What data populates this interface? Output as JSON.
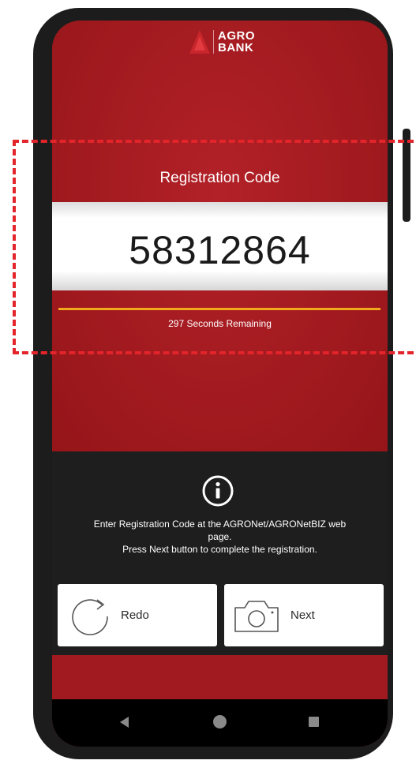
{
  "app": {
    "brand": "AGRO BANK",
    "brand_line1": "AGRO",
    "brand_line2": "BANK"
  },
  "registration": {
    "title": "Registration Code",
    "code": "58312864",
    "remaining_text": "297 Seconds Remaining",
    "progress_fraction": 1.0
  },
  "info": {
    "icon": "info-circle-icon",
    "line1": "Enter Registration Code at the AGRONet/AGRONetBIZ web",
    "line2": "page.",
    "line3": "Press Next button to complete the registration."
  },
  "actions": {
    "redo_label": "Redo",
    "redo_icon": "redo-arrow-icon",
    "next_label": "Next",
    "next_icon": "camera-icon"
  },
  "nav": {
    "back_icon": "back-triangle-icon",
    "home_icon": "home-circle-icon",
    "recent_icon": "recent-square-icon"
  },
  "colors": {
    "brand_red": "#a11a1f",
    "panel_dark": "#1e1e1e",
    "progress_accent": "#f2a81d",
    "highlight_dashed": "#e3242b"
  }
}
